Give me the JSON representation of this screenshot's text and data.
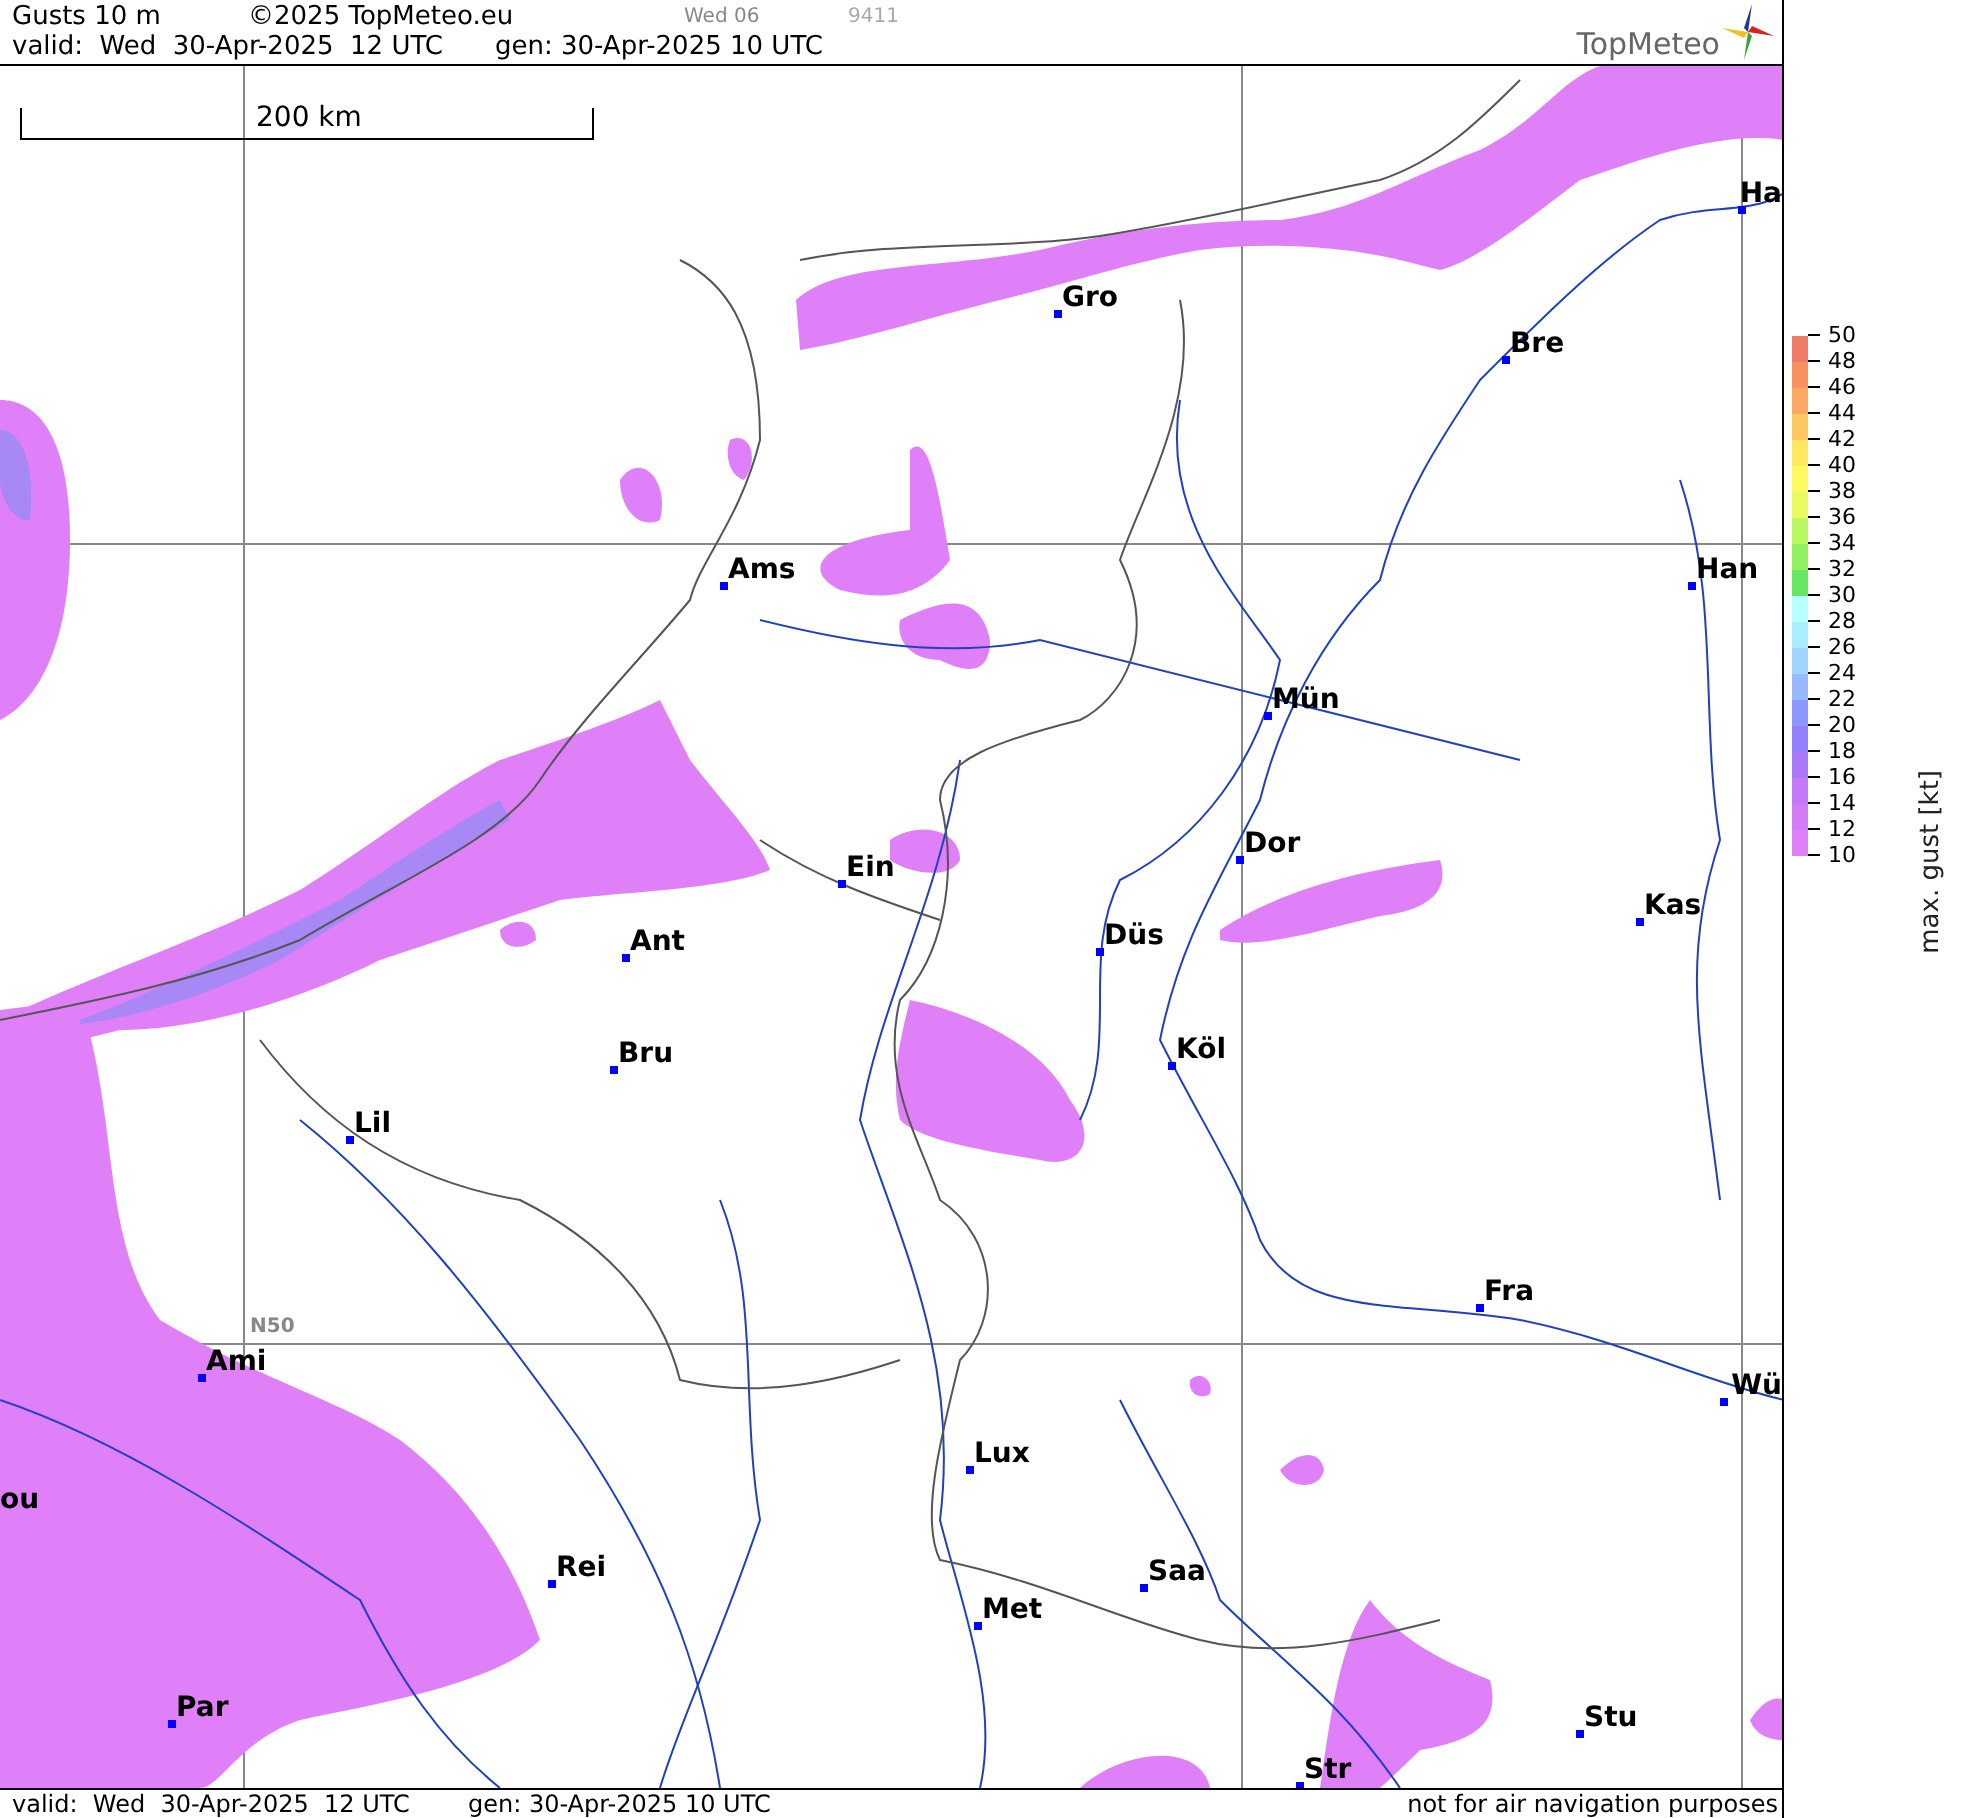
{
  "header": {
    "title": "Gusts 10 m",
    "copyright": "©2025 TopMeteo.eu",
    "day_code": "Wed 06",
    "run_code": "9411",
    "valid": "valid:  Wed  30-Apr-2025  12 UTC",
    "generated": "gen: 30-Apr-2025 10 UTC",
    "logo": "TopMeteo"
  },
  "map": {
    "scale": "200 km",
    "grid_label": "N50",
    "cities": [
      {
        "name": "Ha"
      },
      {
        "name": "Gro"
      },
      {
        "name": "Bre"
      },
      {
        "name": "Ams"
      },
      {
        "name": "Han"
      },
      {
        "name": "Mün"
      },
      {
        "name": "Dor"
      },
      {
        "name": "Ein"
      },
      {
        "name": "Kas"
      },
      {
        "name": "Düs"
      },
      {
        "name": "Ant"
      },
      {
        "name": "Köl"
      },
      {
        "name": "Bru"
      },
      {
        "name": "Lil"
      },
      {
        "name": "Fra"
      },
      {
        "name": "Ami"
      },
      {
        "name": "Wü"
      },
      {
        "name": "ou"
      },
      {
        "name": "Lux"
      },
      {
        "name": "Rei"
      },
      {
        "name": "Saa"
      },
      {
        "name": "Met"
      },
      {
        "name": "Par"
      },
      {
        "name": "Stu"
      },
      {
        "name": "Str"
      }
    ]
  },
  "legend": {
    "title": "max. gust [kt]",
    "ticks": [
      "50",
      "48",
      "46",
      "44",
      "42",
      "40",
      "38",
      "36",
      "34",
      "32",
      "30",
      "28",
      "26",
      "24",
      "22",
      "20",
      "18",
      "16",
      "14",
      "12",
      "10"
    ],
    "bands": [
      {
        "color": "#f07a68"
      },
      {
        "color": "#f89060"
      },
      {
        "color": "#fba860"
      },
      {
        "color": "#fdc860"
      },
      {
        "color": "#fee860"
      },
      {
        "color": "#fffa60"
      },
      {
        "color": "#e8fa60"
      },
      {
        "color": "#b8f860"
      },
      {
        "color": "#90f060"
      },
      {
        "color": "#68e860"
      },
      {
        "color": "#b8ffff"
      },
      {
        "color": "#a8eeff"
      },
      {
        "color": "#a0d4ff"
      },
      {
        "color": "#98b8ff"
      },
      {
        "color": "#8c98ff"
      },
      {
        "color": "#9480ff"
      },
      {
        "color": "#a878f8"
      },
      {
        "color": "#c478f8"
      },
      {
        "color": "#d47cf8"
      },
      {
        "color": "#e080f8"
      }
    ]
  },
  "footer": {
    "valid": "valid:  Wed  30-Apr-2025  12 UTC",
    "generated": "gen: 30-Apr-2025 10 UTC",
    "notice": "not for air navigation purposes"
  }
}
